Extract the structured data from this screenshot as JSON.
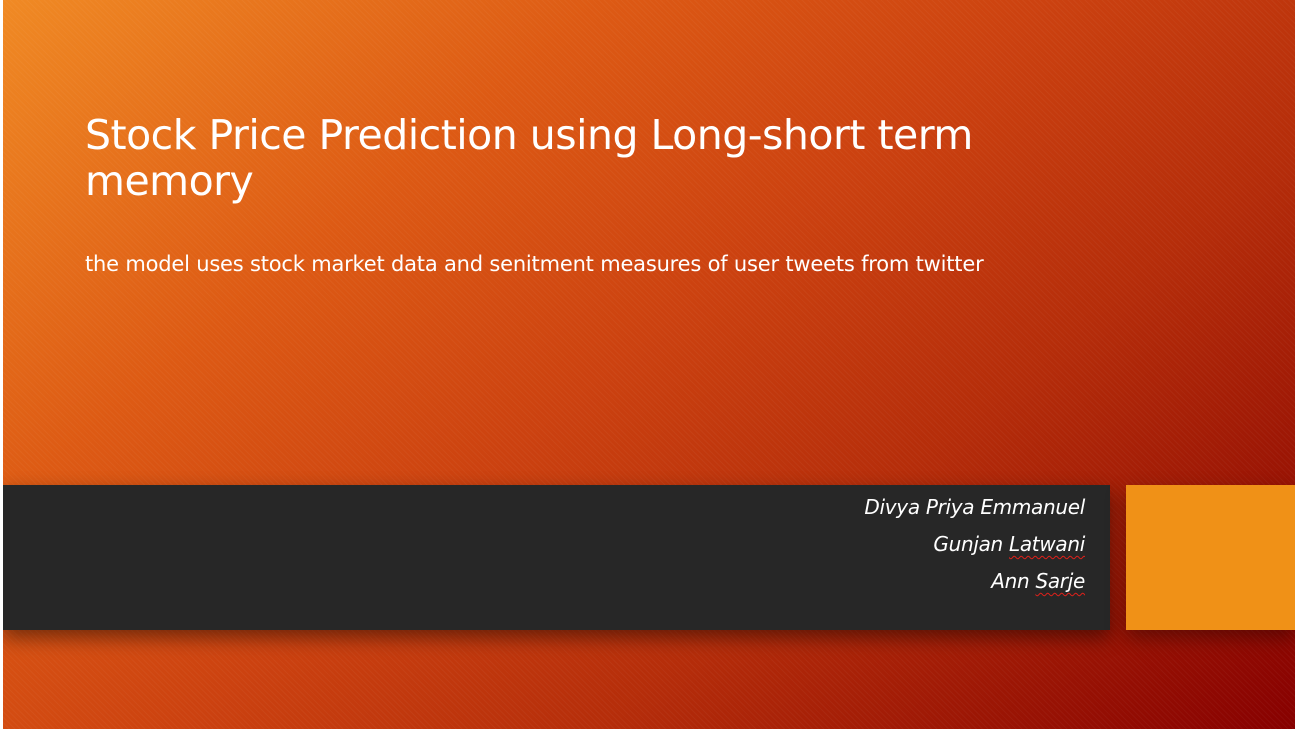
{
  "slide": {
    "title": "Stock Price Prediction using Long-short term memory",
    "subtitle": "the model uses stock market data and senitment measures of user tweets from twitter",
    "authors": [
      {
        "name": "Divya Priya Emmanuel"
      },
      {
        "first": "Gunjan",
        "last": "Latwani"
      },
      {
        "first": "Ann",
        "last": "Sarje"
      }
    ]
  },
  "colors": {
    "gradient_start": "#f08a24",
    "gradient_end": "#870000",
    "band": "#272727",
    "accent": "#f09117",
    "text": "#ffffff",
    "spellcheck_underline": "#e0201a"
  }
}
